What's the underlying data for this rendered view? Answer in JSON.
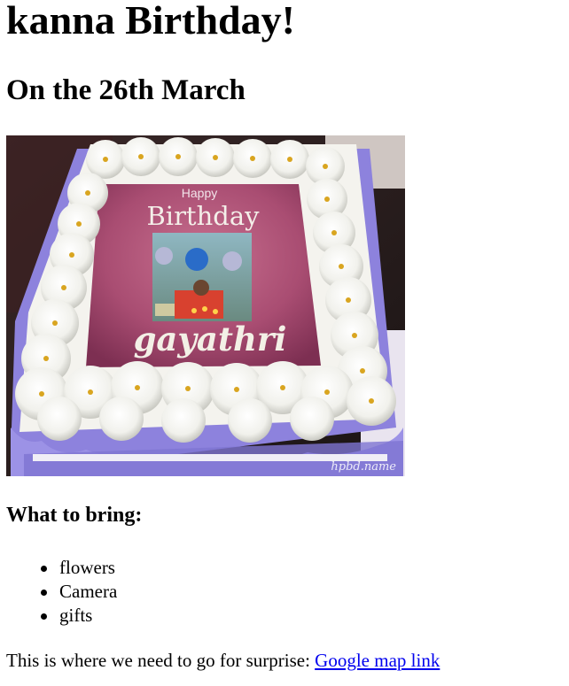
{
  "title": "kanna Birthday!",
  "date_line": "On the 26th March",
  "cake": {
    "happy": "Happy",
    "birthday": "Birthday",
    "name": "gayathri",
    "watermark": "hpbd.name"
  },
  "bring_heading": "What to bring:",
  "bring_items": [
    "flowers",
    "Camera",
    "gifts"
  ],
  "surprise_text": "This is where we need to go for surprise: ",
  "map_link": "Google map link",
  "colors": {
    "link": "#0000ee",
    "cake_frosting_purple": "#8a7fd9",
    "cake_center_pink": "#b0587a"
  }
}
